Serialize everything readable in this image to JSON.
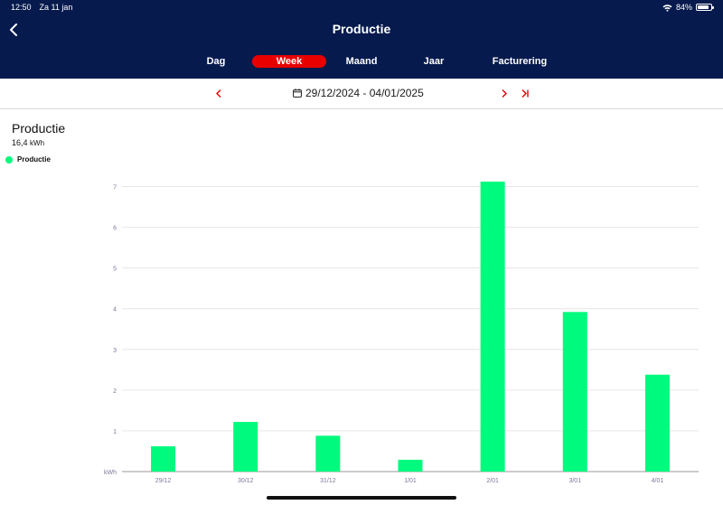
{
  "status": {
    "time": "12:50",
    "date": "Za 11 jan",
    "battery": "84%",
    "battery_level": 0.84
  },
  "header": {
    "title": "Productie"
  },
  "tabs": [
    {
      "label": "Dag",
      "active": false
    },
    {
      "label": "Week",
      "active": true
    },
    {
      "label": "Maand",
      "active": false
    },
    {
      "label": "Jaar",
      "active": false
    },
    {
      "label": "Facturering",
      "active": false
    }
  ],
  "datebar": {
    "range": "29/12/2024 - 04/01/2025"
  },
  "summary": {
    "title": "Productie",
    "total": "16,4",
    "unit": "kWh"
  },
  "colors": {
    "navy": "#061a4e",
    "accent": "#e60000",
    "bar": "#00fa7d",
    "grid": "#e6e6e6"
  },
  "chart_data": {
    "type": "bar",
    "categories": [
      "29/12",
      "30/12",
      "31/12",
      "1/01",
      "2/01",
      "3/01",
      "4/01"
    ],
    "series": [
      {
        "name": "Productie",
        "values": [
          0.62,
          1.22,
          0.88,
          0.29,
          7.12,
          3.92,
          2.38
        ]
      }
    ],
    "ylabel": "kWh",
    "ylim": [
      0,
      7
    ],
    "yticks": [
      1,
      2,
      3,
      4,
      5,
      6,
      7
    ],
    "grid": true,
    "legend": "top-left"
  }
}
